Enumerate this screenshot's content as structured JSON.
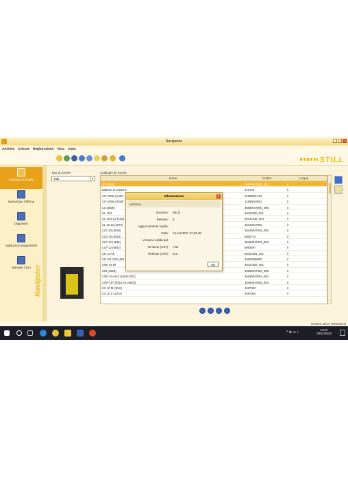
{
  "window": {
    "title": "Navigatore"
  },
  "menu": [
    "Archivio",
    "Cercare",
    "Registrazione",
    "Vista",
    "Aiuto"
  ],
  "brand": {
    "logo": "STILL",
    "sidebar_word": "Navigator"
  },
  "sidebar": {
    "items": [
      {
        "label": "Cataloghi di ricambi",
        "active": true
      },
      {
        "label": "Manuali per l'officina",
        "active": false
      },
      {
        "label": "Diagnostici",
        "active": false
      },
      {
        "label": "Applicazioni diagnostiche",
        "active": false
      },
      {
        "label": "Manuale d'uso",
        "active": false
      }
    ]
  },
  "filter": {
    "label": "Tipo di carrello",
    "value": "Tutti"
  },
  "catalog": {
    "label": "Cataloghi di ricambi",
    "columns": [
      "Nome",
      "Codice",
      "Lingua"
    ],
    "rows": [
      {
        "name": "4D (4506)",
        "code": "45580047900_001",
        "lang": "it"
      },
      {
        "name": "Batterie di Trazione",
        "code": "170702",
        "lang": "it"
      },
      {
        "name": "CITI ONE (1130)",
        "code": "11380011419",
        "lang": "it"
      },
      {
        "name": "CITI ONE (2350)",
        "code": "11380010831",
        "lang": "it"
      },
      {
        "name": "CL (4559)",
        "code": "45580047900_005",
        "lang": "it"
      },
      {
        "name": "CL 10,5",
        "code": "60422380_001",
        "lang": "it"
      },
      {
        "name": "CL 10,5-12 (4523",
        "code": "60422335_004",
        "lang": "it"
      },
      {
        "name": "CL 10-12 (4572)",
        "code": "45720047900",
        "lang": "it"
      },
      {
        "name": "CLD 20 (4544)",
        "code": "45440047815_002",
        "lang": "it"
      },
      {
        "name": "CLD 20 (4913)",
        "code": "6954723",
        "lang": "it"
      },
      {
        "name": "CLP 12 (4545)",
        "code": "45450047815_003",
        "lang": "it"
      },
      {
        "name": "CLP 12 (6914)",
        "code": "6954697",
        "lang": "it"
      },
      {
        "name": "CN 13-18",
        "code": "60422381_001",
        "lang": "it"
      },
      {
        "name": "CN CN CN0 (452",
        "code": "45250098000",
        "lang": "it"
      },
      {
        "name": "CN0 13-20",
        "code": "60422382_001",
        "lang": "it"
      },
      {
        "name": "CNI (4528)",
        "code": "45280047900_006",
        "lang": "it"
      },
      {
        "name": "COP 20+H10 (1000/1001)",
        "code": "45280047803_002",
        "lang": "it"
      },
      {
        "name": "COP-L07 (2015-12 ex803)",
        "code": "45480047803_003",
        "lang": "it"
      },
      {
        "name": "CS 10 M (1041)",
        "code": "4487063",
        "lang": "it"
      },
      {
        "name": "CS 10 Z (1041)",
        "code": "4487064",
        "lang": "it"
      }
    ]
  },
  "dialog": {
    "title": "Informazione",
    "subtitle": "Versione",
    "fields": [
      {
        "key": "Versione:",
        "value": "D8.21"
      },
      {
        "key": "Release:",
        "value": "8"
      },
      {
        "key": "Aggiornamento rapido:",
        "value": ""
      },
      {
        "key": "Data:",
        "value": "14-set-2021 22.29.48"
      },
      {
        "key": "Versione valida dal:",
        "value": ""
      },
      {
        "key": "Versione (JAR):",
        "value": "7.64"
      },
      {
        "key": "Release (JAR):",
        "value": "212"
      }
    ],
    "ok_label": "Ok"
  },
  "statusbar": {
    "version_text": "Versione D8.21 (Release 8)"
  },
  "taskbar": {
    "time": "13:47",
    "date": "08/11/2022"
  },
  "colors": {
    "accent": "#f2b530",
    "sidebar_active": "#e7a21a",
    "brand_yellow": "#f2b800",
    "icon_blue": "#3c5fb0"
  }
}
